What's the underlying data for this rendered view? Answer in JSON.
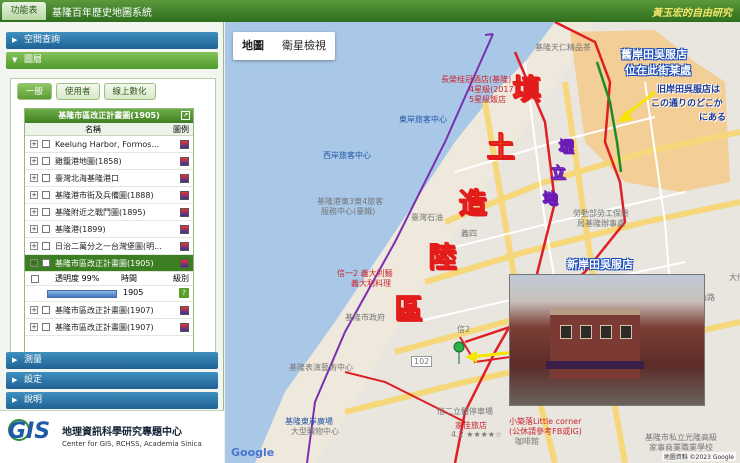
{
  "topbar": {
    "func_tab": "功能表",
    "app_title": "基隆百年歷史地圖系統",
    "brand": "黃玉宏的自由研究"
  },
  "sidebar": {
    "accordion": [
      {
        "label": "空間查詢"
      },
      {
        "label": "圖層"
      },
      {
        "label": "測量"
      },
      {
        "label": "設定"
      },
      {
        "label": "說明"
      }
    ],
    "subtabs": [
      "一般",
      "使用者",
      "線上數化"
    ],
    "grid": {
      "title": "基隆市區改正計畫圖(1905)",
      "col_name": "名稱",
      "col_legend": "圖例",
      "rows": [
        "Keelung Harbor, Formos...",
        "雞籠港地圖(1858)",
        "臺灣北海基隆港口",
        "基隆港市街及兵備圖(1888)",
        "基隆附近之戰鬥圖(1895)",
        "基隆港(1899)",
        "日治二萬分之一台灣堡圖(明...",
        "基隆市區改正計畫圖(1905)"
      ],
      "opacity_label": "透明度 99%",
      "time_label": "時間",
      "level_label": "級別",
      "year_value": "1905",
      "rows_after": [
        "基隆市區改正計畫圖(1907)",
        "基隆市區改正計畫圖(1907)"
      ]
    },
    "pager": {
      "page": "1",
      "total": "/ 6",
      "per_page": "10",
      "count": "51"
    },
    "logo": {
      "gis": "GIS",
      "cn": "地理資訊科學研究專題中心",
      "en": "Center for GIS, RCHSS, Academia Sinica"
    }
  },
  "map": {
    "tabs": [
      "地圖",
      "衛星檢視"
    ],
    "annotation": {
      "landfill": [
        "填",
        "土",
        "造",
        "陸",
        "區"
      ],
      "reclaimed": [
        "埋",
        "立",
        "地"
      ],
      "old_shop": [
        "舊岸田吳服店",
        "位在此街某處"
      ],
      "old_shop_jp": [
        "旧岸田呉服店は",
        "この通りのどこか",
        "にある"
      ],
      "new_shop": "新岸田吳服店"
    },
    "pois": {
      "hotel1": "長榮桂冠酒店(基隆)",
      "hotel1_sub": "4星級(2017)",
      "hotel1_sub2": "5星級飯店",
      "dongan": "東岸旅客中心",
      "west_terminal": "西岸旅客中心",
      "port3": "基隆港東3東4旅客",
      "port3b": "服務中心(臺鐵)",
      "market1": "臺灣石油",
      "square1": "基隆天仁精品茶",
      "shop1": "勞動部勞工保險",
      "shop1b": "局基隆辦事處",
      "yilan": "信一2 義大利麵",
      "yilan_b": "義大利料理",
      "tower": "信2",
      "mrt": "基隆市政府",
      "theater": "基隆表演藝術中心",
      "trademkt": "信二立體停車場",
      "guest": "家佳旅店",
      "guest_b": "4.2 ★★★★☆",
      "cafe": "小築落Little corner",
      "cafe_b": "(公休請參考FB或IG)",
      "cafe_c": "咖啡館",
      "square": "基隆東岸廣場",
      "square_b": "大型購物中心",
      "yi2": "義一1",
      "bus": "102",
      "road1": "仁愛路",
      "library": "基隆市私立光隆高級",
      "library_b": "家事商業職業學校",
      "fuji": "富士",
      "pawn": "東利",
      "roadA": "中正路",
      "roadB": "忠一路",
      "roadC": "信六",
      "roadD": "山路",
      "roadE": "義四",
      "roadF": "大什"
    },
    "footer": "地圖資料 ©2023 Google",
    "google": "Google"
  }
}
